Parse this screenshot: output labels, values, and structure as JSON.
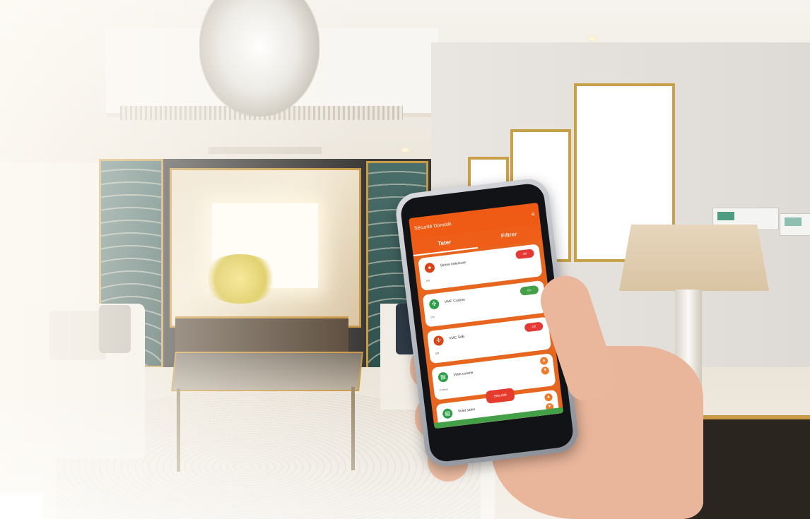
{
  "app": {
    "header_title": "Sécurité Domotik",
    "header_menu_icon": "menu-icon",
    "tabs": [
      {
        "label": "Tster",
        "active": true
      },
      {
        "label": "Filtrer",
        "active": false
      }
    ],
    "devices": [
      {
        "name": "Sirène intérieure",
        "state": "Arr",
        "icon": "siren-icon",
        "icon_color": "#d84315",
        "control": "toggle",
        "toggle_label": "Off",
        "toggle_color": "#e53935"
      },
      {
        "name": "VMC Cuisine",
        "state": "On",
        "icon": "fan-icon",
        "icon_color": "#2e9e48",
        "control": "toggle",
        "toggle_label": "On",
        "toggle_color": "#43a047"
      },
      {
        "name": "VMC SdB",
        "state": "Off",
        "icon": "fan-icon",
        "icon_color": "#d84315",
        "control": "toggle",
        "toggle_label": "Off",
        "toggle_color": "#e53935"
      },
      {
        "name": "Volet cuisine",
        "state": "Fermé",
        "icon": "shutter-icon",
        "icon_color": "#2e9e48",
        "control": "arrows"
      },
      {
        "name": "Volet salon",
        "state": "",
        "icon": "shutter-icon",
        "icon_color": "#2e9e48",
        "control": "arrows"
      }
    ],
    "fab_label": "Sécurité",
    "accent_color": "#ef5a15",
    "success_color": "#43a047"
  }
}
